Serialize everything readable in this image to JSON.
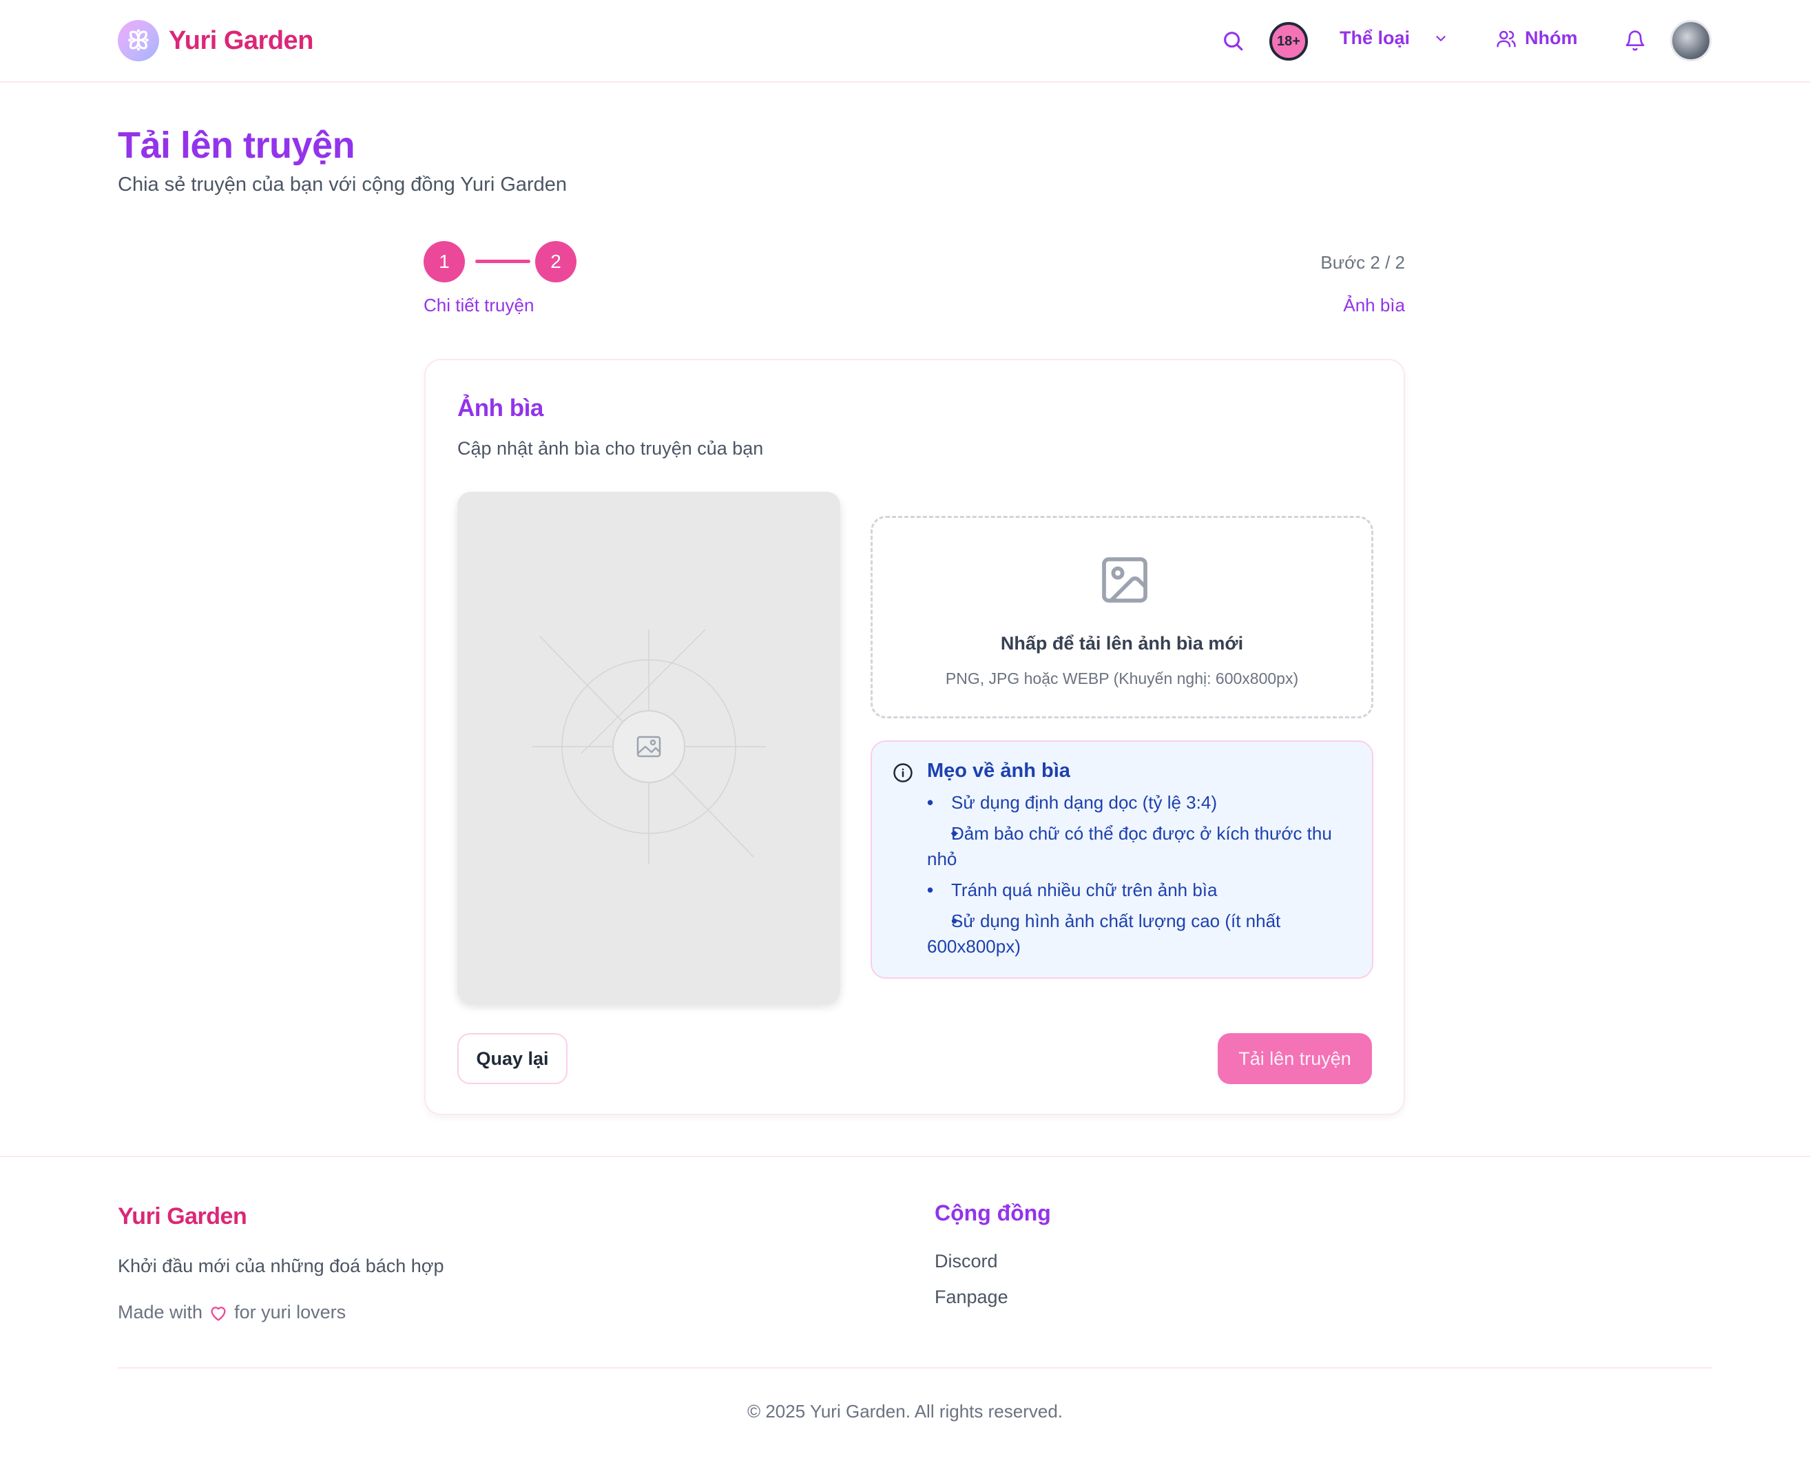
{
  "header": {
    "brand": "Yuri Garden",
    "logo_glyph": "ꕥ",
    "age_badge": "18+",
    "nav_genre": "Thể loại",
    "nav_group": "Nhóm",
    "icons": [
      "search-icon",
      "chevron-down-icon",
      "users-icon",
      "bell-icon",
      "avatar"
    ]
  },
  "page": {
    "title": "Tải lên truyện",
    "subtitle": "Chia sẻ truyện của bạn với cộng đồng Yuri Garden"
  },
  "stepper": {
    "step1_number": "1",
    "step2_number": "2",
    "step1_label": "Chi tiết truyện",
    "step_count": "Bước 2 / 2",
    "step2_label": "Ảnh bìa"
  },
  "card": {
    "title": "Ảnh bìa",
    "subtitle": "Cập nhật ảnh bìa cho truyện của bạn",
    "dropzone_title": "Nhấp để tải lên ảnh bìa mới",
    "dropzone_hint": "PNG, JPG hoặc WEBP (Khuyến nghị: 600x800px)",
    "tips_title": "Mẹo về ảnh bìa",
    "tips": [
      "Sử dụng định dạng dọc (tỷ lệ 3:4)",
      "Đảm bảo chữ có thể đọc được ở kích thước thu nhỏ",
      "Tránh quá nhiều chữ trên ảnh bìa",
      "Sử dụng hình ảnh chất lượng cao (ít nhất 600x800px)"
    ],
    "back_button": "Quay lại",
    "submit_button": "Tải lên truyện"
  },
  "footer": {
    "brand": "Yuri Garden",
    "tagline": "Khởi đầu mới của những đoá bách hợp",
    "made_with_prefix": "Made with",
    "made_with_suffix": "for yuri lovers",
    "community_title": "Cộng đồng",
    "links": [
      "Discord",
      "Fanpage"
    ],
    "copyright": "© 2025 Yuri Garden. All rights reserved."
  },
  "colors": {
    "brand_pink": "#db2777",
    "accent_purple": "#9333ea",
    "step_pink": "#ec4899",
    "tips_blue": "#1e40af",
    "tips_bg": "#eff6ff"
  }
}
